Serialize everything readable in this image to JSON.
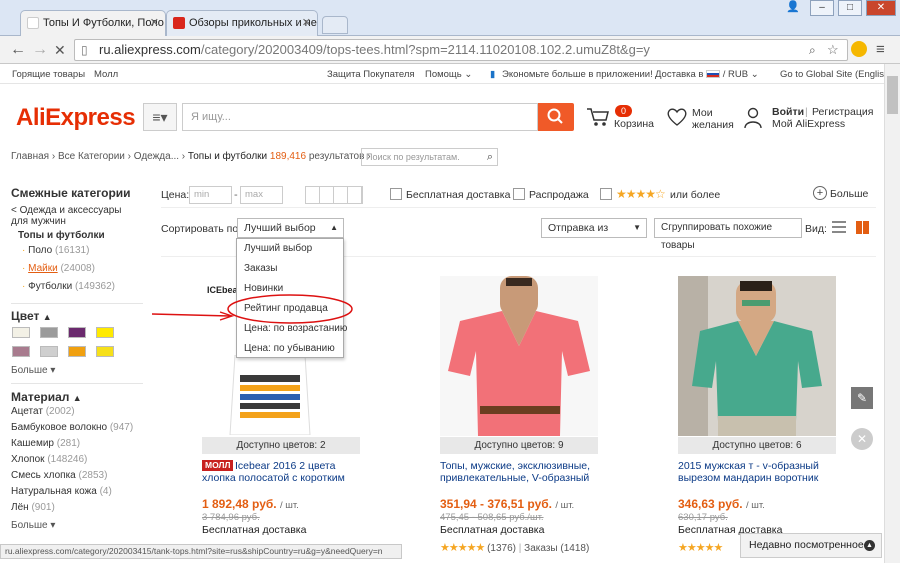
{
  "browser": {
    "tabs": [
      {
        "title": "Топы И Футболки, Поло Ф..."
      },
      {
        "title": "Обзоры прикольных и необ..."
      }
    ],
    "url_host": "ru.aliexpress.com",
    "url_path": "/category/202003409/tops-tees.html?spm=2114.11020108.102.2.umuZ8t&g=y"
  },
  "topnav": {
    "hot": "Горящие товары",
    "mall": "Молл",
    "protection": "Защита Покупателя",
    "help": "Помощь",
    "app": "Экономьте больше в приложении!",
    "delivery": "Доставка в",
    "currency": "RUB",
    "global": "Go to Global Site (English)"
  },
  "header": {
    "logo": "AliExpress",
    "search_placeholder": "Я ищу...",
    "cart_count": "0",
    "cart_label": "Корзина",
    "wishlist_line1": "Мои",
    "wishlist_line2": "желания",
    "signin": "Войти",
    "register": "Регистрация",
    "my_account": "Мой AliExpress"
  },
  "breadcrumb": {
    "path": "Главная › Все Категории › Одежда... › ",
    "current": "Топы и футболки",
    "count": "189,416",
    "results": "результатов ›",
    "search_placeholder": "Поиск по результатам."
  },
  "sidebar": {
    "related_heading": "Смежные категории",
    "parent": "< Одежда и аксессуары",
    "parent2": "для мужчин",
    "current": "Топы и футболки",
    "sub_items": [
      {
        "label": "Поло",
        "count": "(16131)"
      },
      {
        "label": "Майки",
        "count": "(24008)"
      },
      {
        "label": "Футболки",
        "count": "(149362)"
      }
    ],
    "color_heading": "Цвет",
    "more1": "Больше",
    "material_heading": "Материал",
    "materials": [
      {
        "label": "Ацетат",
        "count": "(2002)"
      },
      {
        "label": "Бамбуковое волокно",
        "count": "(947)"
      },
      {
        "label": "Кашемир",
        "count": "(281)"
      },
      {
        "label": "Хлопок",
        "count": "(148246)"
      },
      {
        "label": "Смесь хлопка",
        "count": "(2853)"
      },
      {
        "label": "Натуральная кожа",
        "count": "(4)"
      },
      {
        "label": "Лён",
        "count": "(901)"
      }
    ],
    "more2": "Больше",
    "swatch_colors": [
      "#f3f1e6",
      "#9b9b9b",
      "#6b2a6e",
      "#ffea00",
      "#a87b8e",
      "#cfcfcf",
      "#f0a010",
      "#f6e01a"
    ]
  },
  "filters": {
    "price_label": "Цена:",
    "min_placeholder": "min",
    "max_placeholder": "max",
    "free_shipping": "Бесплатная доставка",
    "sale": "Распродажа",
    "rating_more": "или более",
    "more": "Больше",
    "sort_label": "Сортировать по:",
    "sort_value": "Лучший выбор",
    "ship_from": "Отправка из",
    "group_similar": "Сгруппировать похожие товары",
    "view_label": "Вид:"
  },
  "sort_options": [
    "Лучший выбор",
    "Заказы",
    "Новинки",
    "Рейтинг продавца",
    "Цена: по возрастанию",
    "Цена: по убыванию"
  ],
  "products": [
    {
      "brand_tag": "ICEbea",
      "colors": "Доступно цветов: 2",
      "mall_badge": "МОЛЛ",
      "title_line1": "Icebear 2016 2 цвета",
      "title_line2": "хлопка полосатой с коротким",
      "price": "1 892,48 руб.",
      "unit": "/ шт.",
      "old_price": "3 784,96 руб.",
      "shipping": "Бесплатная доставка"
    },
    {
      "colors": "Доступно цветов: 9",
      "title_line1": "Топы, мужские, эксклюзивные,",
      "title_line2": "привлекательные, V-образный",
      "price": "351,94 - 376,51 руб.",
      "unit": "/ шт.",
      "old_price": "475,45 - 508,65 руб./шт.",
      "shipping": "Бесплатная доставка",
      "reviews": "(1376)",
      "orders": "Заказы (1418)"
    },
    {
      "colors": "Доступно цветов: 6",
      "title_line1": "2015 мужская т - v-образный",
      "title_line2": "вырезом мандарин воротник",
      "price": "346,63 руб.",
      "unit": "/ шт.",
      "old_price": "630,17 руб.",
      "shipping": "Бесплатная доставка"
    }
  ],
  "statusbar": "ru.aliexpress.com/category/202003415/tank-tops.html?site=rus&shipCountry=ru&g=y&needQuery=n",
  "recently_viewed": "Недавно посмотренное",
  "accent_color": "#e62e04",
  "price_color": "#e35e12"
}
